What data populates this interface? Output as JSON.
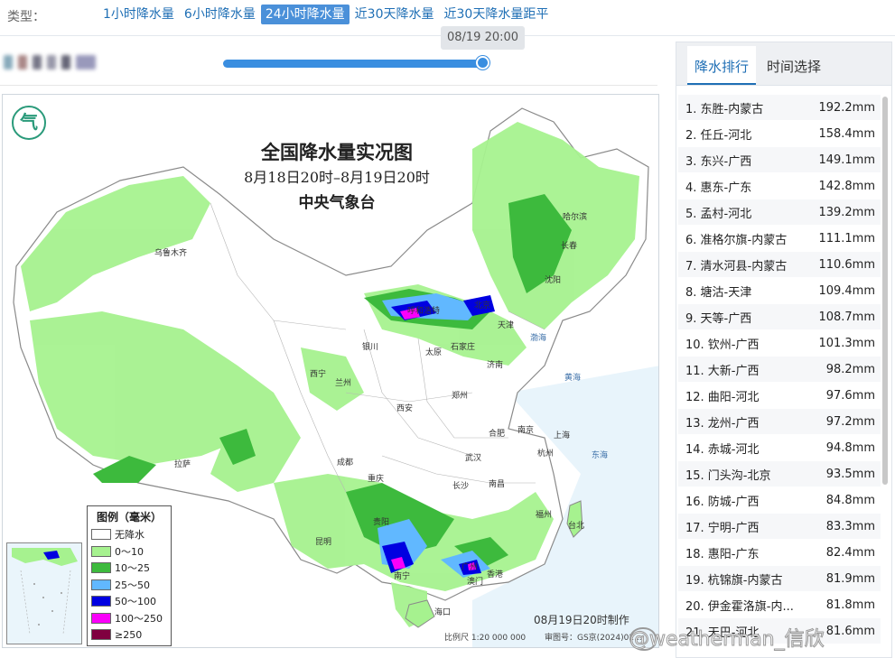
{
  "type_bar": {
    "label": "类型：",
    "tabs": [
      "1小时降水量",
      "6小时降水量",
      "24小时降水量",
      "近30天降水量",
      "近30天降水量距平"
    ],
    "active_index": 2
  },
  "timeline": {
    "tooltip": "08/19 20:00",
    "progress": 1.0
  },
  "map": {
    "title": "全国降水量实况图",
    "subtitle": "8月18日20时–8月19日20时",
    "issuer": "中央气象台",
    "made_time": "08月19日20时制作",
    "scale": "比例尺 1:20 000 000",
    "review_no": "审图号：GS京(2024)02...",
    "cities": [
      "乌鲁木齐",
      "哈尔滨",
      "长春",
      "沈阳",
      "北京",
      "天津",
      "石家庄",
      "太原",
      "呼和浩特",
      "银川",
      "西宁",
      "兰州",
      "济南",
      "郑州",
      "西安",
      "合肥",
      "南京",
      "上海",
      "杭州",
      "武汉",
      "成都",
      "重庆",
      "拉萨",
      "长沙",
      "南昌",
      "福州",
      "台北",
      "贵阳",
      "昆明",
      "南宁",
      "广州",
      "香港",
      "澳门",
      "海口"
    ],
    "seas": [
      "渤海",
      "黄海",
      "东海"
    ],
    "legend": {
      "title": "图例（毫米）",
      "items": [
        {
          "label": "无降水",
          "color": "#ffffff"
        },
        {
          "label": "0～10",
          "color": "#a6f28f"
        },
        {
          "label": "10～25",
          "color": "#3dba3d"
        },
        {
          "label": "25～50",
          "color": "#61b8ff"
        },
        {
          "label": "50～100",
          "color": "#0000e1"
        },
        {
          "label": "100～250",
          "color": "#fa00fa"
        },
        {
          "label": "≥250",
          "color": "#800040"
        }
      ]
    }
  },
  "ranking": {
    "tabs": [
      "降水排行",
      "时间选择"
    ],
    "active_index": 0,
    "rows": [
      {
        "name": "1. 东胜-内蒙古",
        "value": "192.2mm"
      },
      {
        "name": "2. 任丘-河北",
        "value": "158.4mm"
      },
      {
        "name": "3. 东兴-广西",
        "value": "149.1mm"
      },
      {
        "name": "4. 惠东-广东",
        "value": "142.8mm"
      },
      {
        "name": "5. 孟村-河北",
        "value": "139.2mm"
      },
      {
        "name": "6. 准格尔旗-内蒙古",
        "value": "111.1mm"
      },
      {
        "name": "7. 清水河县-内蒙古",
        "value": "110.6mm"
      },
      {
        "name": "8. 塘沽-天津",
        "value": "109.4mm"
      },
      {
        "name": "9. 天等-广西",
        "value": "108.7mm"
      },
      {
        "name": "10. 钦州-广西",
        "value": "101.3mm"
      },
      {
        "name": "11. 大新-广西",
        "value": "98.2mm"
      },
      {
        "name": "12. 曲阳-河北",
        "value": "97.6mm"
      },
      {
        "name": "13. 龙州-广西",
        "value": "97.2mm"
      },
      {
        "name": "14. 赤城-河北",
        "value": "94.8mm"
      },
      {
        "name": "15. 门头沟-北京",
        "value": "93.5mm"
      },
      {
        "name": "16. 防城-广西",
        "value": "84.8mm"
      },
      {
        "name": "17. 宁明-广西",
        "value": "83.3mm"
      },
      {
        "name": "18. 惠阳-广东",
        "value": "82.4mm"
      },
      {
        "name": "19. 杭锦旗-内蒙古",
        "value": "81.9mm"
      },
      {
        "name": "20. 伊金霍洛旗-内...",
        "value": "81.8mm"
      },
      {
        "name": "21. 天巴-河北",
        "value": "81.6mm"
      }
    ]
  },
  "watermark": "@weatherman_信欣"
}
